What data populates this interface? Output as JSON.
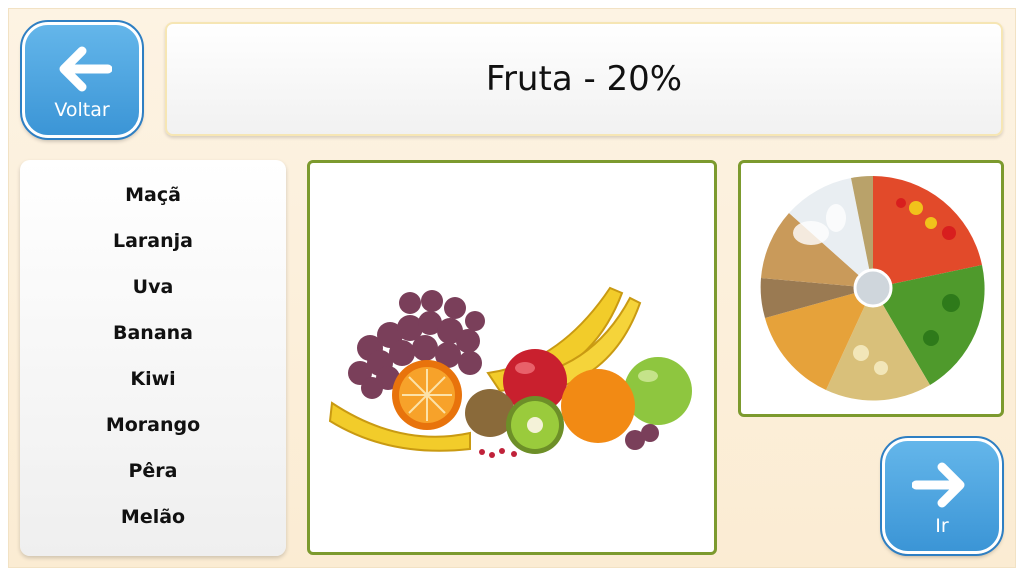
{
  "header": {
    "title": "Fruta - 20%"
  },
  "nav": {
    "back_label": "Voltar",
    "next_label": "Ir"
  },
  "fruit_list": [
    "Maçã",
    "Laranja",
    "Uva",
    "Banana",
    "Kiwi",
    "Morango",
    "Pêra",
    "Melão"
  ],
  "colors": {
    "button_blue": "#4aa3e0",
    "panel_border_green": "#7c9a2e",
    "background": "#fdf3e3"
  }
}
